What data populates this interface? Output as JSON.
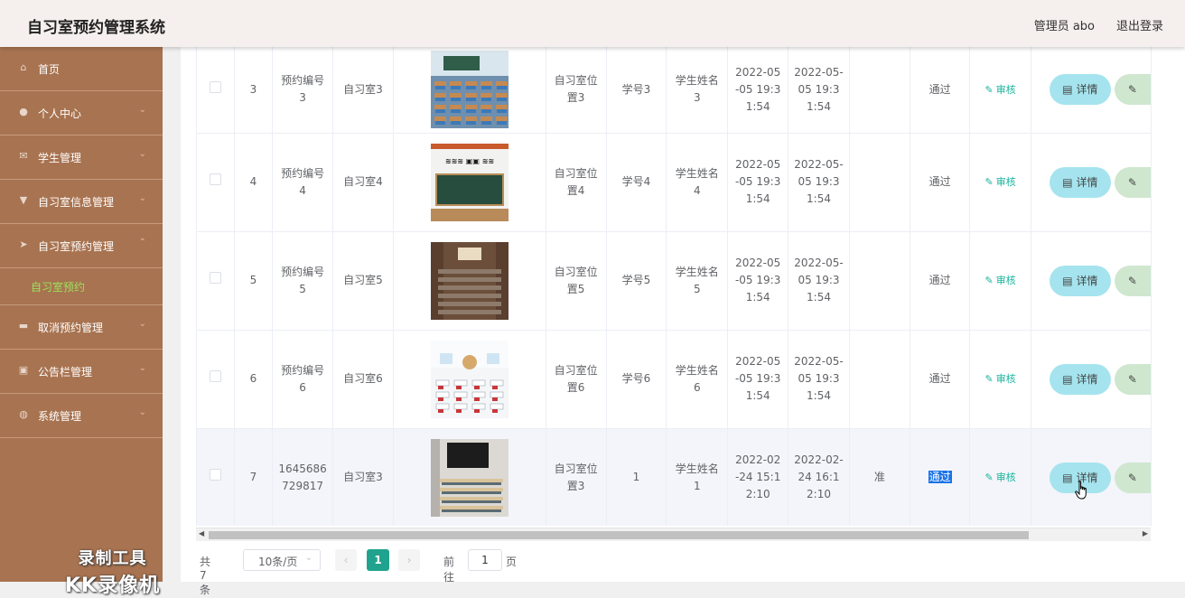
{
  "header": {
    "title": "自习室预约管理系统",
    "admin": "管理员 abo",
    "logout": "退出登录"
  },
  "sidebar": {
    "items": [
      {
        "label": "首页",
        "icon": "home-icon",
        "glyph": "⌂",
        "arrow": ""
      },
      {
        "label": "个人中心",
        "icon": "user-icon",
        "glyph": "●",
        "arrow": "⌄"
      },
      {
        "label": "学生管理",
        "icon": "mail-icon",
        "glyph": "✉",
        "arrow": "⌄"
      },
      {
        "label": "自习室信息管理",
        "icon": "pin-icon",
        "glyph": "▼",
        "arrow": "⌄"
      },
      {
        "label": "自习室预约管理",
        "icon": "send-icon",
        "glyph": "➤",
        "arrow": "⌃"
      },
      {
        "label": "取消预约管理",
        "icon": "briefcase-icon",
        "glyph": "▬",
        "arrow": "⌄"
      },
      {
        "label": "公告栏管理",
        "icon": "notice-icon",
        "glyph": "▣",
        "arrow": "⌄"
      },
      {
        "label": "系统管理",
        "icon": "globe-icon",
        "glyph": "◍",
        "arrow": "⌄"
      }
    ],
    "active_sub": "自习室预约",
    "watermark_line1": "录制工具",
    "watermark_line2": "KK录像机"
  },
  "rows": [
    {
      "index": "3",
      "booking_no": "预约编号3",
      "room": "自习室3",
      "location": "自习室位置3",
      "student_id": "学号3",
      "student_name": "学生姓名3",
      "start": "2022-05-05 19:31:54",
      "end": "2022-05-05 19:31:54",
      "reply": "",
      "status": "通过",
      "audit": "审核",
      "detail": "详情",
      "image_kind": "classroom-blue"
    },
    {
      "index": "4",
      "booking_no": "预约编号4",
      "room": "自习室4",
      "location": "自习室位置4",
      "student_id": "学号4",
      "student_name": "学生姓名4",
      "start": "2022-05-05 19:31:54",
      "end": "2022-05-05 19:31:54",
      "reply": "",
      "status": "通过",
      "audit": "审核",
      "detail": "详情",
      "image_kind": "blackboard"
    },
    {
      "index": "5",
      "booking_no": "预约编号5",
      "room": "自习室5",
      "location": "自习室位置5",
      "student_id": "学号5",
      "student_name": "学生姓名5",
      "start": "2022-05-05 19:31:54",
      "end": "2022-05-05 19:31:54",
      "reply": "",
      "status": "通过",
      "audit": "审核",
      "detail": "详情",
      "image_kind": "auditorium"
    },
    {
      "index": "6",
      "booking_no": "预约编号6",
      "room": "自习室6",
      "location": "自习室位置6",
      "student_id": "学号6",
      "student_name": "学生姓名6",
      "start": "2022-05-05 19:31:54",
      "end": "2022-05-05 19:31:54",
      "reply": "",
      "status": "通过",
      "audit": "审核",
      "detail": "详情",
      "image_kind": "bright-classroom"
    },
    {
      "index": "7",
      "booking_no": "1645686729817",
      "room": "自习室3",
      "location": "自习室位置3",
      "student_id": "1",
      "student_name": "学生姓名1",
      "start": "2022-02-24 15:12:10",
      "end": "2022-02-24 16:12:10",
      "reply": "准",
      "status": "通过",
      "audit": "审核",
      "detail": "详情",
      "image_kind": "tv-room"
    }
  ],
  "pagination": {
    "total": "共 7 条",
    "page_size": "10条/页",
    "current_page": "1",
    "goto_label": "前往",
    "goto_value": "1",
    "page_unit": "页"
  }
}
